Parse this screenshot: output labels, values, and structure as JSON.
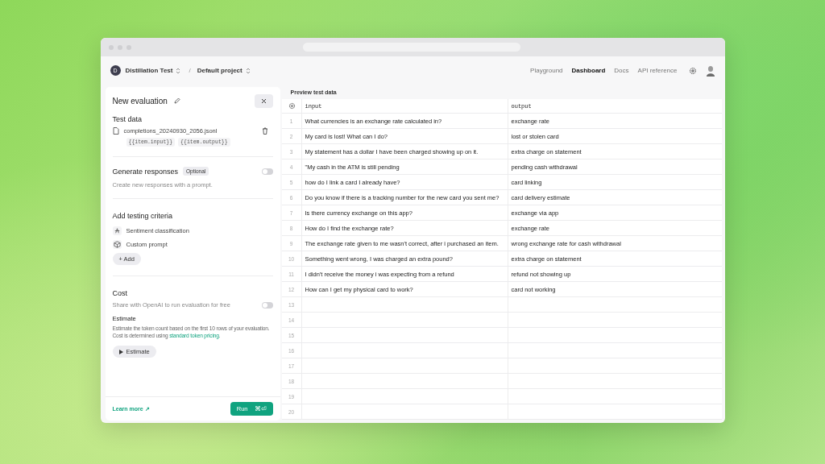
{
  "header": {
    "org": {
      "initial": "D",
      "name": "Distillation Test"
    },
    "separator": "/",
    "project": "Default project",
    "nav": [
      {
        "label": "Playground",
        "selected": false
      },
      {
        "label": "Dashboard",
        "selected": true
      },
      {
        "label": "Docs",
        "selected": false
      },
      {
        "label": "API reference",
        "selected": false
      }
    ]
  },
  "panel": {
    "title": "New evaluation",
    "test_data": {
      "heading": "Test data",
      "file": "completions_20240930_2056.jsonl",
      "tags": [
        "{{item.input}}",
        "{{item.output}}"
      ]
    },
    "generate": {
      "heading": "Generate responses",
      "badge": "Optional",
      "on": false,
      "description": "Create new responses with a prompt."
    },
    "criteria": {
      "heading": "Add testing criteria",
      "items": [
        {
          "label": "Sentiment classification",
          "kind": "classifier"
        },
        {
          "label": "Custom prompt",
          "kind": "prompt"
        }
      ],
      "add_button": "+ Add"
    },
    "cost": {
      "heading": "Cost",
      "share_label": "Share with OpenAI to run evaluation for free",
      "share_on": false,
      "estimate_heading": "Estimate",
      "estimate_text": "Estimate the token count based on the first 10 rows of your evaluation. Cost is determined using",
      "estimate_link": "standard token pricing",
      "estimate_end": ".",
      "estimate_button": "Estimate"
    },
    "footer": {
      "learn_more": "Learn more ↗",
      "run_button": "Run",
      "run_shortcut": "⌘⏎"
    }
  },
  "preview": {
    "title": "Preview test data",
    "columns": [
      "input",
      "output"
    ],
    "rows": [
      {
        "n": "1",
        "input": "What currencies is an exchange rate calculated in?",
        "output": "exchange rate"
      },
      {
        "n": "2",
        "input": "My card is lost! What can I do?",
        "output": "lost or stolen card"
      },
      {
        "n": "3",
        "input": "My statement has a dollar I have been charged showing up on it.",
        "output": "extra charge on statement"
      },
      {
        "n": "4",
        "input": "\"My cash in the ATM is still pending",
        "output": "pending cash withdrawal"
      },
      {
        "n": "5",
        "input": "how do I link a card I already have?",
        "output": "card linking"
      },
      {
        "n": "6",
        "input": "Do you know if there is a tracking number for the new card you sent me?",
        "output": "card delivery estimate"
      },
      {
        "n": "7",
        "input": "Is there currency exchange on this app?",
        "output": "exchange via app"
      },
      {
        "n": "8",
        "input": "How do I find the exchange rate?",
        "output": "exchange rate"
      },
      {
        "n": "9",
        "input": "The exchange rate given to me wasn't correct, after i purchased an item.",
        "output": "wrong exchange rate for cash withdrawal"
      },
      {
        "n": "10",
        "input": "Something went wrong, I was charged an extra pound?",
        "output": "extra charge on statement"
      },
      {
        "n": "11",
        "input": "I didn't receive the money i was expecting from a refund",
        "output": "refund not showing up"
      },
      {
        "n": "12",
        "input": "How can I get my physical card to work?",
        "output": "card not working"
      },
      {
        "n": "13"
      },
      {
        "n": "14"
      },
      {
        "n": "15"
      },
      {
        "n": "16"
      },
      {
        "n": "17"
      },
      {
        "n": "18"
      },
      {
        "n": "19"
      },
      {
        "n": "20"
      }
    ]
  }
}
